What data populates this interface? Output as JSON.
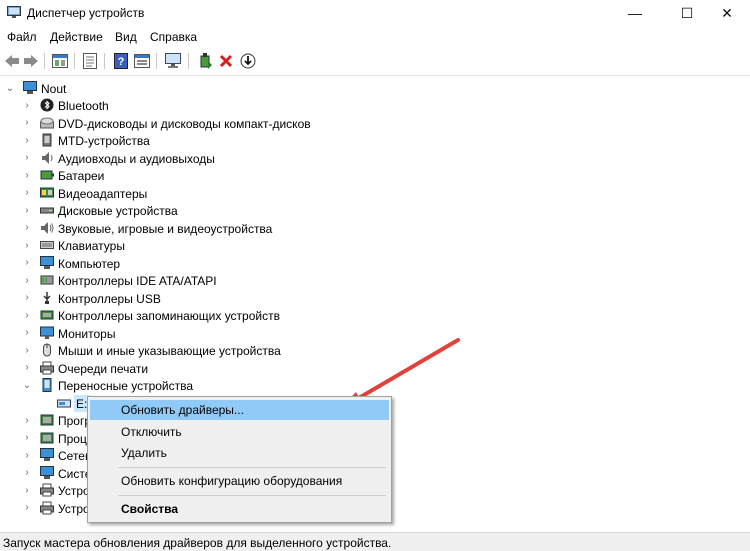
{
  "window": {
    "title": "Диспетчер устройств",
    "min_glyph": "—",
    "max_glyph": "☐",
    "close_glyph": "✕"
  },
  "menu": [
    "Файл",
    "Действие",
    "Вид",
    "Справка"
  ],
  "tree": {
    "root": "Nout",
    "items": [
      {
        "label": "Bluetooth",
        "icon": "bluetooth-icon"
      },
      {
        "label": "DVD-дисководы и дисководы компакт-дисков",
        "icon": "dvd-drive-icon"
      },
      {
        "label": "MTD-устройства",
        "icon": "mtd-device-icon"
      },
      {
        "label": "Аудиовходы и аудиовыходы",
        "icon": "speaker-icon"
      },
      {
        "label": "Батареи",
        "icon": "battery-icon"
      },
      {
        "label": "Видеоадаптеры",
        "icon": "display-adapter-icon"
      },
      {
        "label": "Дисковые устройства",
        "icon": "disk-drive-icon"
      },
      {
        "label": "Звуковые, игровые и видеоустройства",
        "icon": "sound-icon"
      },
      {
        "label": "Клавиатуры",
        "icon": "keyboard-icon"
      },
      {
        "label": "Компьютер",
        "icon": "computer-icon"
      },
      {
        "label": "Контроллеры IDE ATA/ATAPI",
        "icon": "ide-controller-icon"
      },
      {
        "label": "Контроллеры USB",
        "icon": "usb-icon"
      },
      {
        "label": "Контроллеры запоминающих устройств",
        "icon": "storage-controller-icon"
      },
      {
        "label": "Мониторы",
        "icon": "monitor-icon"
      },
      {
        "label": "Мыши и иные указывающие устройства",
        "icon": "mouse-icon"
      },
      {
        "label": "Очереди печати",
        "icon": "printer-icon"
      },
      {
        "label": "Переносные устройства",
        "icon": "portable-device-icon"
      }
    ],
    "child": "E:",
    "partial_items": [
      "Прогр",
      "Проц",
      "Сетев",
      "Систе",
      "Устро",
      "Устро"
    ]
  },
  "context_menu": {
    "update": "Обновить драйверы...",
    "disable": "Отключить",
    "remove": "Удалить",
    "scan": "Обновить конфигурацию оборудования",
    "properties": "Свойства"
  },
  "status": "Запуск мастера обновления драйверов для выделенного устройства.",
  "colors": {
    "highlight": "#91c9f7",
    "arrow": "#e0413a",
    "menu_bg": "#f0f0f0"
  }
}
